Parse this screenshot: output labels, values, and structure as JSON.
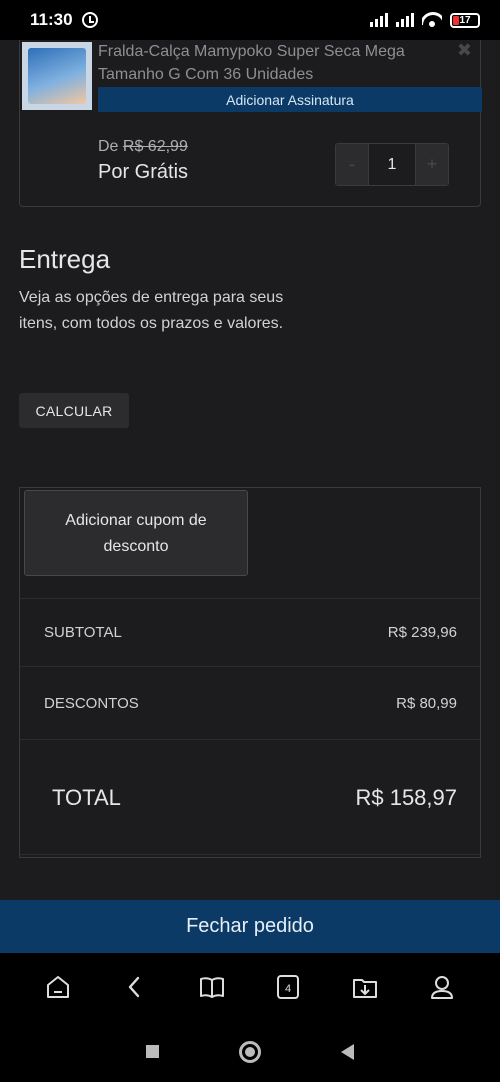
{
  "status": {
    "time": "11:30",
    "battery": "17"
  },
  "product": {
    "title": "Fralda-Calça Mamypoko Super Seca Mega Tamanho G Com 36 Unidades",
    "subscribe_label": "Adicionar Assinatura",
    "old_price_prefix": "De",
    "old_price": "R$ 62,99",
    "price": "Por Grátis",
    "quantity": "1",
    "minus_label": "-",
    "plus_label": "+",
    "close_label": "✖"
  },
  "delivery": {
    "title": "Entrega",
    "description": "Veja as opções de entrega para seus itens, com todos os prazos e valores.",
    "calculate_label": "CALCULAR"
  },
  "summary": {
    "coupon_label": "Adicionar cupom de desconto",
    "subtotal_label": "SUBTOTAL",
    "subtotal_value": "R$ 239,96",
    "discounts_label": "DESCONTOS",
    "discounts_value": "R$ 80,99",
    "total_label": "TOTAL",
    "total_value": "R$ 158,97"
  },
  "checkout": {
    "label": "Fechar pedido"
  },
  "toolbar": {
    "tabs_count": "4",
    "icons": [
      "home-icon",
      "back-icon",
      "bookmarks-icon",
      "tabs-icon",
      "downloads-icon",
      "profile-icon"
    ]
  },
  "colors": {
    "accent": "#0b3a66",
    "background": "#1c1c1e",
    "border": "#3a3a3c"
  }
}
